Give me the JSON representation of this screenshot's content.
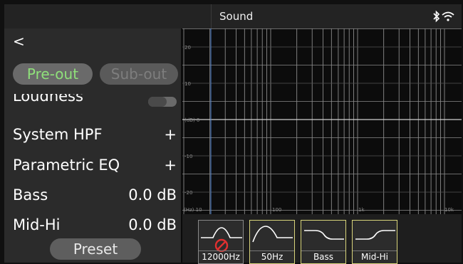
{
  "statusbar": {
    "title": "Sound"
  },
  "left": {
    "back_label": "<",
    "tabs": [
      {
        "label": "Pre-out",
        "active": true
      },
      {
        "label": "Sub-out",
        "active": false
      }
    ],
    "loudness": {
      "label": "Loudness",
      "enabled": false
    },
    "system_hpf": {
      "label": "System HPF",
      "action": "+"
    },
    "parametric_eq": {
      "label": "Parametric EQ",
      "action": "+"
    },
    "bass": {
      "label": "Bass",
      "value": "0.0 dB"
    },
    "mid_hi": {
      "label": "Mid-Hi",
      "value": "0.0 dB"
    },
    "preset_label": "Preset"
  },
  "graph": {
    "y_labels": [
      "20",
      "10",
      "(dB) 0",
      "-10",
      "-20"
    ],
    "x_labels": [
      "(Hz) 10",
      "100",
      "1k",
      "10k"
    ],
    "grid_color": "#9a9a9a",
    "marker_color": "#4a7fd0"
  },
  "filters": [
    {
      "caption": "12000Hz",
      "icon": "peak-curve-disabled-icon",
      "border": "gray"
    },
    {
      "caption": "50Hz",
      "icon": "peak-curve-icon",
      "border": "yellow"
    },
    {
      "caption": "Bass",
      "icon": "low-shelf-icon",
      "border": "yellow"
    },
    {
      "caption": "Mid-Hi",
      "icon": "high-shelf-icon",
      "border": "yellow"
    }
  ],
  "colors": {
    "accent_green": "#8fe07a",
    "card_yellow": "#d8d47a",
    "disabled_red": "#e03030"
  }
}
